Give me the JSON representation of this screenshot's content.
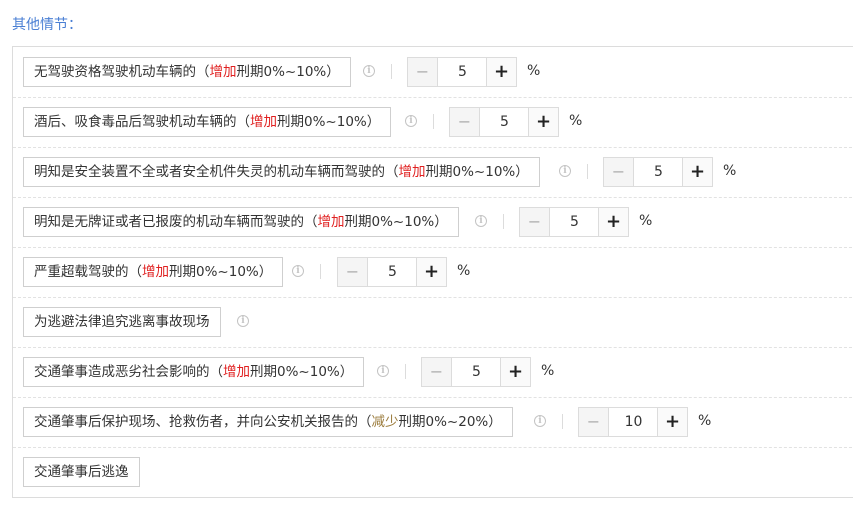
{
  "section_title": "其他情节：",
  "info_glyph": "i",
  "minus_glyph": "−",
  "plus_glyph": "+",
  "colors": {
    "increase": "#e02020",
    "decrease": "#9a7a3a",
    "title": "#4a7fd4"
  },
  "rows": [
    {
      "pre": "无驾驶资格驾驶机动车辆的（",
      "hl": "增加",
      "post": "刑期0%~10%）",
      "value": "5",
      "unit": "%"
    },
    {
      "pre": "酒后、吸食毒品后驾驶机动车辆的（",
      "hl": "增加",
      "post": "刑期0%~10%）",
      "value": "5",
      "unit": "%"
    },
    {
      "pre": "明知是安全装置不全或者安全机件失灵的机动车辆而驾驶的（",
      "hl": "增加",
      "post": "刑期0%~10%）",
      "value": "5",
      "unit": "%"
    },
    {
      "pre": "明知是无牌证或者已报废的机动车辆而驾驶的（",
      "hl": "增加",
      "post": "刑期0%~10%）",
      "value": "5",
      "unit": "%"
    },
    {
      "pre": "严重超载驾驶的（",
      "hl": "增加",
      "post": "刑期0%~10%）",
      "value": "5",
      "unit": "%"
    },
    {
      "pre": "为逃避法律追究逃离事故现场",
      "hl": "",
      "post": ""
    },
    {
      "pre": "交通肇事造成恶劣社会影响的（",
      "hl": "增加",
      "post": "刑期0%~10%）",
      "value": "5",
      "unit": "%"
    },
    {
      "pre": "交通肇事后保护现场、抢救伤者，并向公安机关报告的（",
      "hl": "减少",
      "post": "刑期0%~20%）",
      "value": "10",
      "unit": "%"
    },
    {
      "pre": "交通肇事后逃逸",
      "hl": "",
      "post": ""
    }
  ]
}
